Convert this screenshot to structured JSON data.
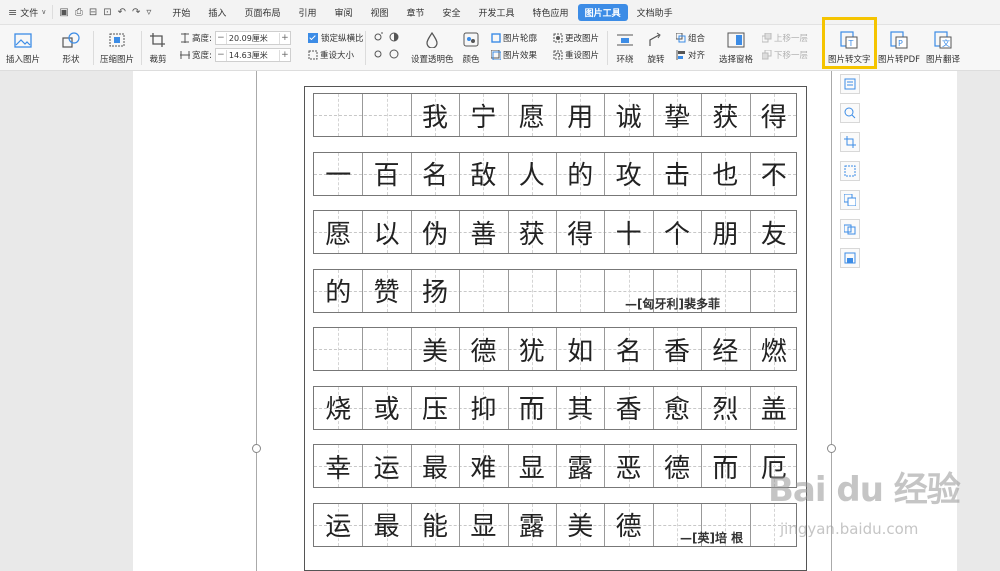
{
  "menubar": {
    "file_label": "文件",
    "tabs": [
      "开始",
      "插入",
      "页面布局",
      "引用",
      "审阅",
      "视图",
      "章节",
      "安全",
      "开发工具",
      "特色应用",
      "图片工具",
      "文档助手"
    ],
    "active_tab": "图片工具"
  },
  "ribbon": {
    "insert_picture": "插入图片",
    "shape": "形状",
    "compress_picture": "压缩图片",
    "crop": "裁剪",
    "height_label": "高度:",
    "height_value": "20.09厘米",
    "width_label": "宽度:",
    "width_value": "14.63厘米",
    "lock_ratio": "锁定纵横比",
    "reset_size": "重设大小",
    "set_transparent": "设置透明色",
    "color": "颜色",
    "picture_outline": "图片轮廓",
    "picture_effect": "图片效果",
    "change_picture": "更改图片",
    "reset_picture": "重设图片",
    "wrap": "环绕",
    "rotate": "旋转",
    "group": "组合",
    "align": "对齐",
    "selection_pane": "选择窗格",
    "bring_forward": "上移一层",
    "send_backward": "下移一层",
    "pic_to_text": "图片转文字",
    "pic_to_pdf": "图片转PDF",
    "pic_translate": "图片翻译",
    "accent_color": "#3c8ce6",
    "highlight_color": "#f5c400"
  },
  "document": {
    "rows": [
      [
        "",
        "",
        "我",
        "宁",
        "愿",
        "用",
        "诚",
        "挚",
        "获",
        "得"
      ],
      [
        "一",
        "百",
        "名",
        "敌",
        "人",
        "的",
        "攻",
        "击",
        "也",
        "不"
      ],
      [
        "愿",
        "以",
        "伪",
        "善",
        "获",
        "得",
        "十",
        "个",
        "朋",
        "友"
      ],
      [
        "的",
        "赞",
        "扬",
        "",
        "",
        "",
        "",
        "",
        "",
        ""
      ],
      [
        "",
        "",
        "美",
        "德",
        "犹",
        "如",
        "名",
        "香",
        "经",
        "燃"
      ],
      [
        "烧",
        "或",
        "压",
        "抑",
        "而",
        "其",
        "香",
        "愈",
        "烈",
        "盖"
      ],
      [
        "幸",
        "运",
        "最",
        "难",
        "显",
        "露",
        "恶",
        "德",
        "而",
        "厄"
      ],
      [
        "运",
        "最",
        "能",
        "显",
        "露",
        "美",
        "德",
        "",
        "",
        ""
      ]
    ],
    "attribution_1": "—[匈牙利]裴多菲",
    "attribution_2": "—[英]培 根"
  },
  "float_toolbar": [
    "ocr-icon",
    "zoom-icon",
    "crop-icon",
    "resize-icon",
    "replace-icon",
    "copy-icon",
    "save-icon"
  ],
  "watermark": {
    "brand": "Bai du 经验",
    "url": "jingyan.baidu.com"
  }
}
